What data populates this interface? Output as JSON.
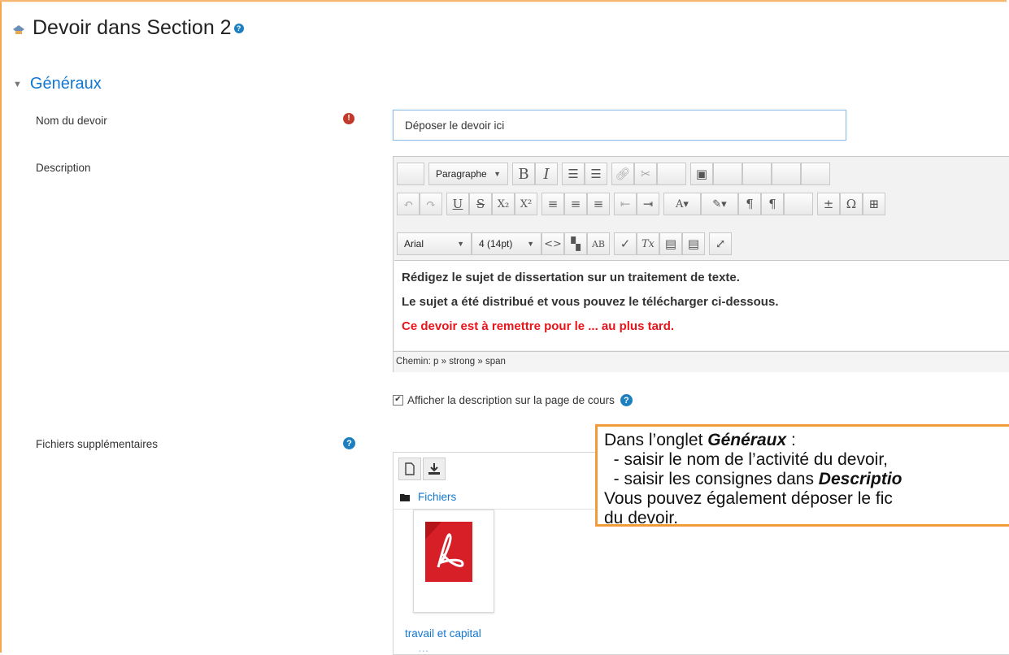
{
  "page": {
    "title": "Devoir dans Section 2"
  },
  "section": {
    "title": "Généraux"
  },
  "fields": {
    "name_label": "Nom du devoir",
    "name_value": "Déposer le devoir ici",
    "description_label": "Description",
    "files_label": "Fichiers supplémentaires",
    "show_description_label": "Afficher la description sur la page de cours",
    "show_description_checked": true
  },
  "editor": {
    "format_select": "Paragraphe",
    "font_select": "Arial",
    "size_select": "4 (14pt)",
    "lines": [
      "Rédigez le sujet de dissertation sur un traitement de texte.",
      "Le sujet a été distribué et vous pouvez le télécharger ci-dessous.",
      "Ce devoir est à remettre pour le ... au plus tard."
    ],
    "line_colors": [
      "#000000",
      "#000000",
      "#e8141b"
    ],
    "path": "Chemin: p » strong » span"
  },
  "filepicker": {
    "folder": "Fichiers",
    "file_name": "travail et capital",
    "file_name_second_line": "…"
  },
  "callout": {
    "line1_prefix": "Dans l’onglet ",
    "line1_emph": "Généraux",
    "line1_suffix": " :",
    "line2": "  - saisir le nom de l’activité du devoir,",
    "line3_prefix": "  - saisir les consignes dans ",
    "line3_emph": "Descriptio",
    "line4": "Vous pouvez également déposer le fic",
    "line5": "du devoir."
  },
  "colors": {
    "accent_blue": "#1177d1",
    "frame_orange": "#f5a64c",
    "required_red": "#c0392b"
  },
  "icons": [
    "activity-icon",
    "help-icon",
    "caret-down-icon",
    "required-icon",
    "new-file-icon",
    "download-icon",
    "folder-icon",
    "pdf-icon"
  ]
}
